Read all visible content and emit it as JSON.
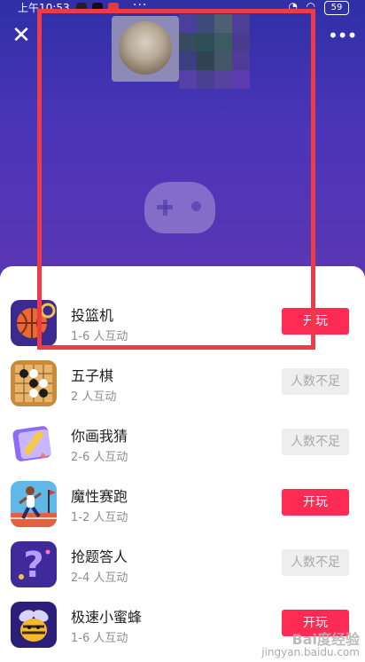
{
  "status_bar": {
    "time": "上午10:53",
    "battery": "59"
  },
  "header": {
    "close_icon": "close-icon",
    "more_icon": "more-icon"
  },
  "colors": {
    "top_bg_start": "#2f2fa6",
    "top_bg_end": "#5b36b3",
    "play_button": "#fe2c55",
    "highlight_box": "#ef3b48",
    "disabled_button": "#eeeeee"
  },
  "games": [
    {
      "name": "投篮机",
      "players": "1-6 人互动",
      "action": "开玩",
      "enabled": true,
      "icon": "basketball-icon"
    },
    {
      "name": "五子棋",
      "players": "2 人互动",
      "action": "人数不足",
      "enabled": false,
      "icon": "gomoku-icon"
    },
    {
      "name": "你画我猜",
      "players": "2-6 人互动",
      "action": "人数不足",
      "enabled": false,
      "icon": "draw-guess-icon"
    },
    {
      "name": "魔性赛跑",
      "players": "1-2 人互动",
      "action": "开玩",
      "enabled": true,
      "icon": "runner-icon"
    },
    {
      "name": "抢题答人",
      "players": "2-4 人互动",
      "action": "人数不足",
      "enabled": false,
      "icon": "question-icon"
    },
    {
      "name": "极速小蜜蜂",
      "players": "1-6 人互动",
      "action": "开玩",
      "enabled": true,
      "icon": "bee-icon"
    }
  ],
  "watermark": {
    "line1": "Bai度经验",
    "line2": "jingyan.baidu.com"
  }
}
